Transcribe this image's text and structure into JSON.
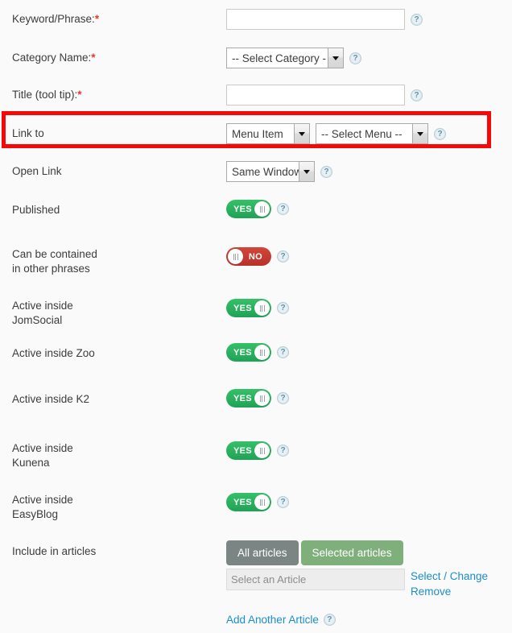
{
  "colors": {
    "page_bg": "#fafafa",
    "highlight": "#f50808",
    "toggle_on": "#1fa355",
    "toggle_off": "#b8322a",
    "link": "#1a8ecb",
    "btn_all": "#7b8584",
    "btn_selected": "#7fb07b",
    "required": "#e03a2f"
  },
  "help_icon_glyph": "?",
  "fields": {
    "keyword": {
      "label": "Keyword/Phrase:",
      "required": true,
      "value": "",
      "placeholder": "",
      "help": "help-icon"
    },
    "category": {
      "label": "Category Name:",
      "required": true,
      "selected": "-- Select Category - -",
      "help": "help-icon"
    },
    "title_tooltip": {
      "label": "Title (tool tip):",
      "required": true,
      "value": "",
      "placeholder": "",
      "help": "help-icon"
    },
    "link_to": {
      "label": "Link to",
      "required": false,
      "type_selected": "Menu Item",
      "menu_selected": "-- Select Menu --",
      "help": "help-icon",
      "highlighted": true
    },
    "open_link": {
      "label": "Open Link",
      "required": false,
      "selected": "Same Window",
      "help": "help-icon"
    },
    "published": {
      "label": "Published",
      "state": "YES",
      "on": true,
      "help": "help-icon"
    },
    "can_be_contained": {
      "label": "Can be contained in other phrases",
      "label_line1": "Can be contained",
      "label_line2": "in other phrases",
      "state": "NO",
      "on": false,
      "help": "help-icon"
    },
    "active_jomsocial": {
      "label": "Active inside JomSocial",
      "label_line1": "Active inside",
      "label_line2": "JomSocial",
      "state": "YES",
      "on": true,
      "help": "help-icon"
    },
    "active_zoo": {
      "label": "Active inside Zoo",
      "label_line1": "Active inside Zoo",
      "label_line2": "",
      "state": "YES",
      "on": true,
      "help": "help-icon"
    },
    "active_k2": {
      "label": "Active inside K2",
      "label_line1": "Active inside K2",
      "label_line2": "",
      "state": "YES",
      "on": true,
      "help": "help-icon"
    },
    "active_kunena": {
      "label": "Active inside Kunena",
      "label_line1": "Active inside",
      "label_line2": "Kunena",
      "state": "YES",
      "on": true,
      "help": "help-icon"
    },
    "active_easyblog": {
      "label": "Active inside EasyBlog",
      "label_line1": "Active inside",
      "label_line2": "EasyBlog",
      "state": "YES",
      "on": true,
      "help": "help-icon"
    },
    "include_in_articles": {
      "label": "Include in articles",
      "btn_all_articles": "All articles",
      "btn_selected_articles": "Selected articles",
      "article_input_value": "",
      "article_input_placeholder": "Select an Article",
      "link_select_change": "Select / Change",
      "link_remove": "Remove",
      "link_add_another": "Add Another Article",
      "help": "help-icon"
    }
  }
}
